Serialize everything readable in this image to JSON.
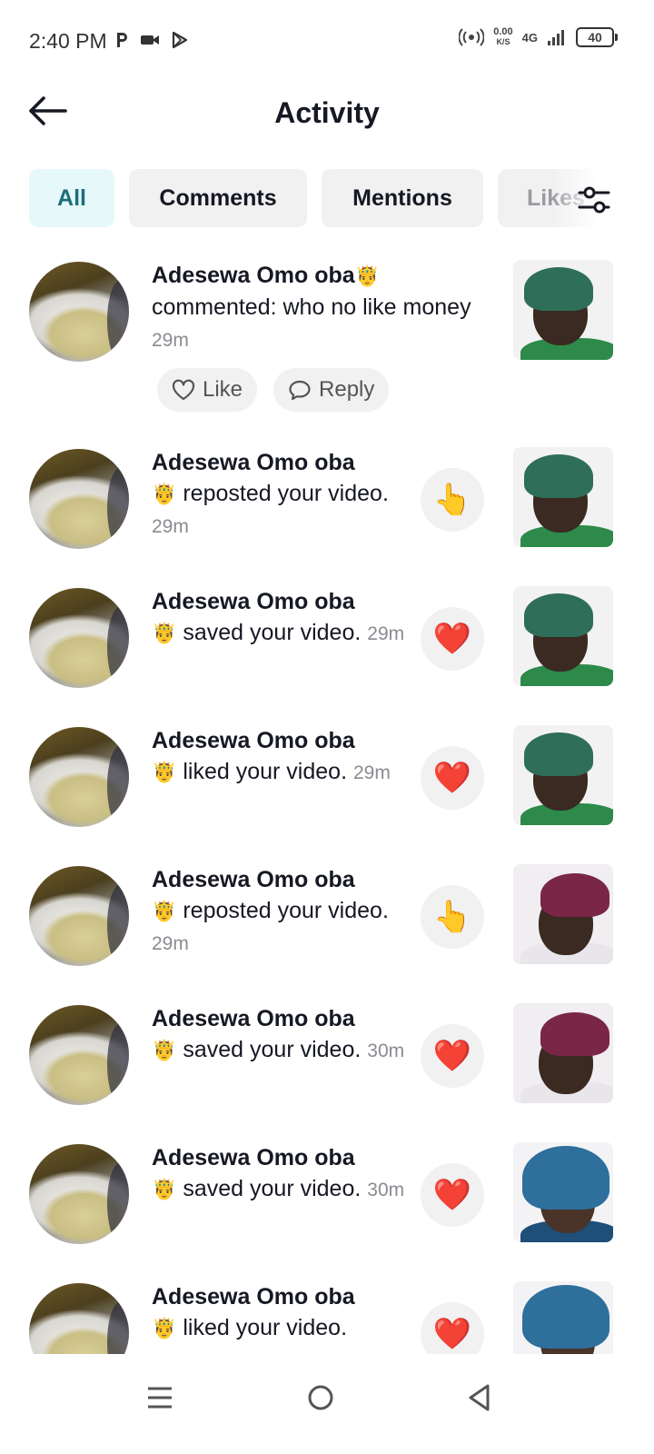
{
  "status_bar": {
    "time": "2:40 PM",
    "left_icons": [
      "parking-icon",
      "video-camera-icon",
      "play-store-icon"
    ],
    "net_speed_value": "0.00",
    "net_speed_unit": "K/S",
    "network_type": "4G",
    "battery": "40"
  },
  "header": {
    "title": "Activity",
    "back_icon": "arrow-left-icon"
  },
  "tabs": [
    {
      "label": "All",
      "active": true
    },
    {
      "label": "Comments",
      "active": false
    },
    {
      "label": "Mentions",
      "active": false
    },
    {
      "label": "Likes",
      "active": false
    }
  ],
  "filter_icon": "sliders-icon",
  "comment_item": {
    "username": "Adesewa Omo oba",
    "crown": "🤴",
    "text": "commented: who no like money",
    "time": "29m",
    "like_label": "Like",
    "reply_label": "Reply"
  },
  "items": [
    {
      "username": "Adesewa Omo oba",
      "crown": "🤴",
      "text": "reposted your video.",
      "time": "29m",
      "reaction": "👆",
      "reaction_icon": "repost-hand-icon",
      "thumb": "green"
    },
    {
      "username": "Adesewa Omo oba",
      "crown": "🤴",
      "text": "saved your video.",
      "time": "29m",
      "reaction": "❤️",
      "reaction_icon": "heart-icon",
      "thumb": "green"
    },
    {
      "username": "Adesewa Omo oba",
      "crown": "🤴",
      "text": "liked your video.",
      "time": "29m",
      "reaction": "❤️",
      "reaction_icon": "heart-icon",
      "thumb": "green"
    },
    {
      "username": "Adesewa Omo oba",
      "crown": "🤴",
      "text": "reposted your video.",
      "time": "29m",
      "reaction": "👆",
      "reaction_icon": "repost-hand-icon",
      "thumb": "purple"
    },
    {
      "username": "Adesewa Omo oba",
      "crown": "🤴",
      "text": "saved your video.",
      "time": "30m",
      "reaction": "❤️",
      "reaction_icon": "heart-icon",
      "thumb": "purple"
    },
    {
      "username": "Adesewa Omo oba",
      "crown": "🤴",
      "text": "saved your video.",
      "time": "30m",
      "reaction": "❤️",
      "reaction_icon": "heart-icon",
      "thumb": "blue"
    },
    {
      "username": "Adesewa Omo oba",
      "crown": "🤴",
      "text": "liked your video.",
      "time": "",
      "reaction": "❤️",
      "reaction_icon": "heart-icon",
      "thumb": "blue"
    }
  ],
  "nav_bar": {
    "icons": [
      "menu-icon",
      "home-circle-icon",
      "back-triangle-icon"
    ]
  },
  "colors": {
    "active_tab_bg": "#e6f8fa",
    "active_tab_text": "#1b6f79",
    "tab_bg": "#f1f1f2",
    "heart": "#fe2c55"
  }
}
